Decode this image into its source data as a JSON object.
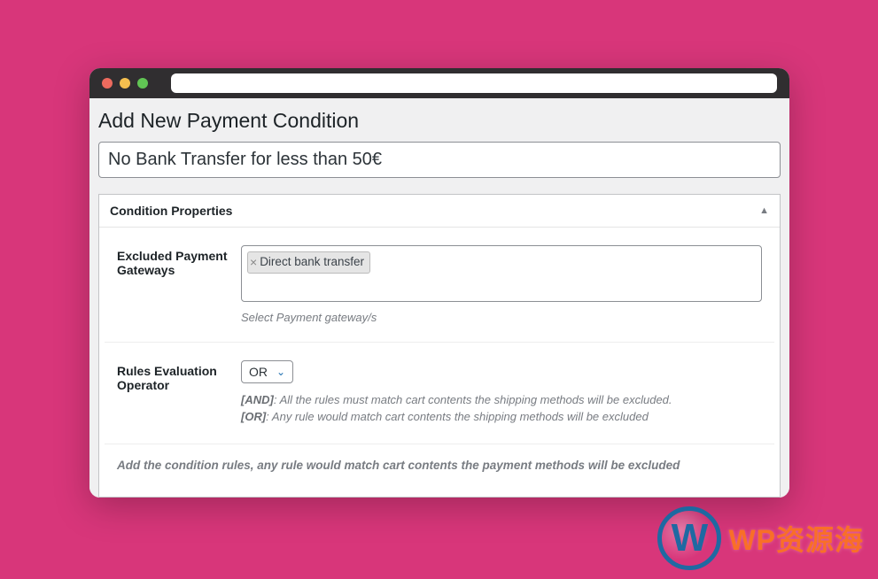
{
  "page": {
    "title": "Add New Payment Condition"
  },
  "condition": {
    "name": "No Bank Transfer for less than 50€"
  },
  "panel": {
    "title": "Condition Properties"
  },
  "fields": {
    "gateways": {
      "label": "Excluded Payment Gateways",
      "tags": [
        "Direct bank transfer"
      ],
      "help": "Select Payment gateway/s"
    },
    "operator": {
      "label": "Rules Evaluation Operator",
      "value": "OR",
      "and_key": "[AND]",
      "and_text": ": All the rules must match cart contents the shipping methods will be excluded.",
      "or_key": "[OR]",
      "or_text": ": Any rule would match cart contents the shipping methods will be excluded"
    }
  },
  "footer_note": "Add the condition rules, any rule would match cart contents the payment methods will be excluded",
  "watermark": {
    "logo_letter": "W",
    "text": "WP资源海"
  }
}
